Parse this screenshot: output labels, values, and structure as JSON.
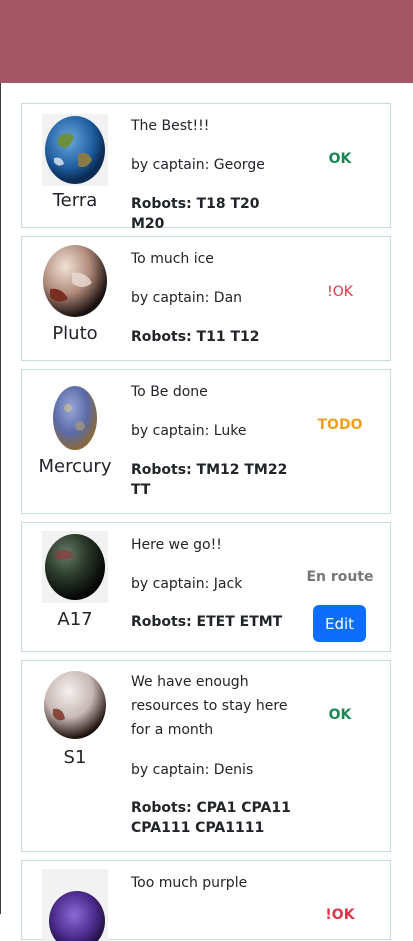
{
  "colors": {
    "header": "#a35664",
    "ok": "#198754",
    "not_ok": "#dc3545",
    "todo": "#f0a020",
    "en_route": "#777777",
    "edit_button": "#0d6efd"
  },
  "missions": [
    {
      "planet": "Terra",
      "description": "The Best!!!",
      "captain": "by captain: George",
      "robots": "Robots: T18 T20 M20",
      "status": "OK",
      "status_color": "#198754",
      "image_icon": "earth-icon"
    },
    {
      "planet": "Pluto",
      "description": "To much ice",
      "captain": "by captain: Dan",
      "robots": "Robots: T11 T12",
      "status": "!OK",
      "status_color": "#dc3545",
      "image_icon": "pluto-icon"
    },
    {
      "planet": "Mercury",
      "description": "To Be done",
      "captain": "by captain: Luke",
      "robots": "Robots: TM12 TM22 TT",
      "status": "TODO",
      "status_color": "#f0a020",
      "image_icon": "mercury-icon"
    },
    {
      "planet": "A17",
      "description": "Here we go!!",
      "captain": "by captain: Jack",
      "robots": "Robots: ETET ETMT",
      "status": "En route",
      "status_color": "#777777",
      "edit_label": "Edit",
      "image_icon": "a17-planet-icon"
    },
    {
      "planet": "S1",
      "description": "We have enough resources to stay here for a month",
      "captain": "by captain: Denis",
      "robots": "Robots: CPA1 CPA11 CPA111 CPA1111",
      "status": "OK",
      "status_color": "#198754",
      "image_icon": "s1-planet-icon"
    },
    {
      "description": "Too much purple",
      "status": "!OK",
      "status_color": "#dc3545",
      "image_icon": "purple-planet-icon"
    }
  ]
}
